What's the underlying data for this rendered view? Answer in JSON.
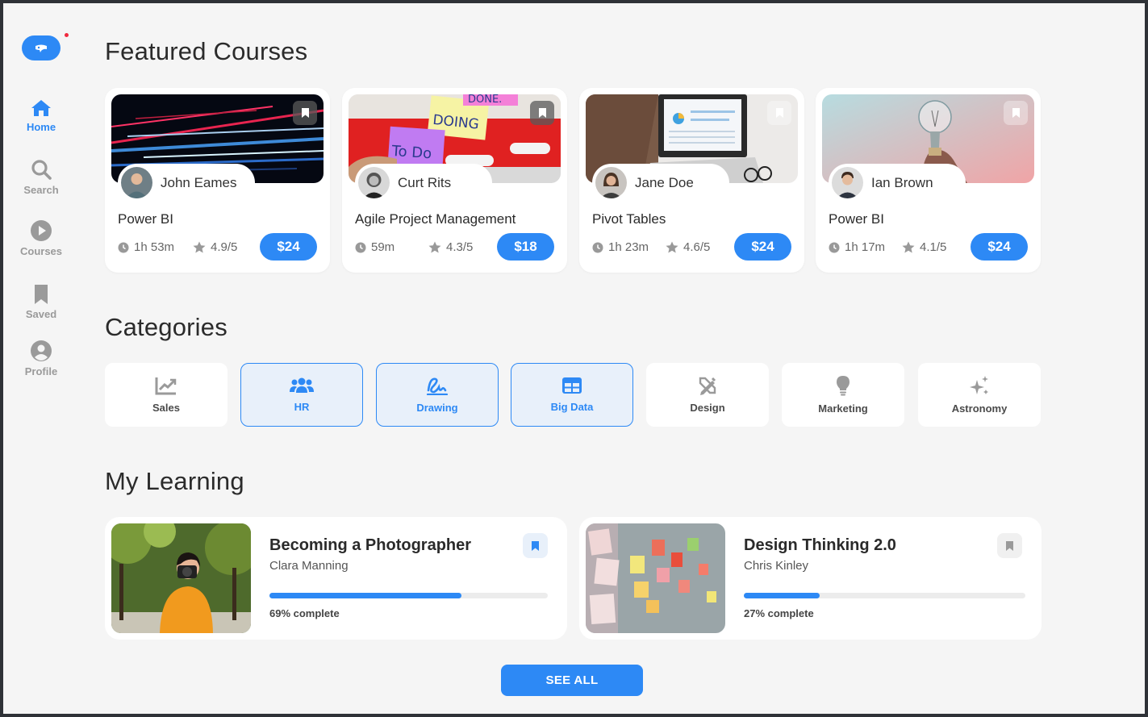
{
  "sidebar": {
    "items": [
      {
        "label": "Home",
        "icon": "home-icon",
        "active": true
      },
      {
        "label": "Search",
        "icon": "search-icon"
      },
      {
        "label": "Courses",
        "icon": "play-circle-icon"
      },
      {
        "label": "Saved",
        "icon": "bookmark-icon"
      },
      {
        "label": "Profile",
        "icon": "user-circle-icon"
      }
    ]
  },
  "featured": {
    "title": "Featured Courses",
    "courses": [
      {
        "title": "Power BI",
        "author": "John Eames",
        "duration": "1h 53m",
        "rating": "4.9/5",
        "price": "$24"
      },
      {
        "title": "Agile Project Management",
        "author": "Curt Rits",
        "duration": "59m",
        "rating": "4.3/5",
        "price": "$18"
      },
      {
        "title": "Pivot Tables",
        "author": "Jane Doe",
        "duration": "1h 23m",
        "rating": "4.6/5",
        "price": "$24"
      },
      {
        "title": "Power BI",
        "author": "Ian Brown",
        "duration": "1h 17m",
        "rating": "4.1/5",
        "price": "$24"
      }
    ]
  },
  "categories": {
    "title": "Categories",
    "items": [
      {
        "label": "Sales",
        "icon": "chart-line-icon",
        "selected": false
      },
      {
        "label": "HR",
        "icon": "users-icon",
        "selected": true
      },
      {
        "label": "Drawing",
        "icon": "signature-icon",
        "selected": true
      },
      {
        "label": "Big Data",
        "icon": "table-icon",
        "selected": true
      },
      {
        "label": "Design",
        "icon": "pencil-ruler-icon",
        "selected": false
      },
      {
        "label": "Marketing",
        "icon": "lightbulb-icon",
        "selected": false
      },
      {
        "label": "Astronomy",
        "icon": "sparkles-icon",
        "selected": false
      }
    ]
  },
  "learning": {
    "title": "My Learning",
    "items": [
      {
        "title": "Becoming a Photographer",
        "author": "Clara Manning",
        "progress": 0.69,
        "progress_label": "69% complete",
        "saved": true
      },
      {
        "title": "Design Thinking 2.0",
        "author": "Chris Kinley",
        "progress": 0.27,
        "progress_label": "27% complete",
        "saved": false
      }
    ],
    "see_all": "SEE ALL"
  },
  "colors": {
    "accent": "#2d89f5",
    "background": "#f5f5f5"
  }
}
